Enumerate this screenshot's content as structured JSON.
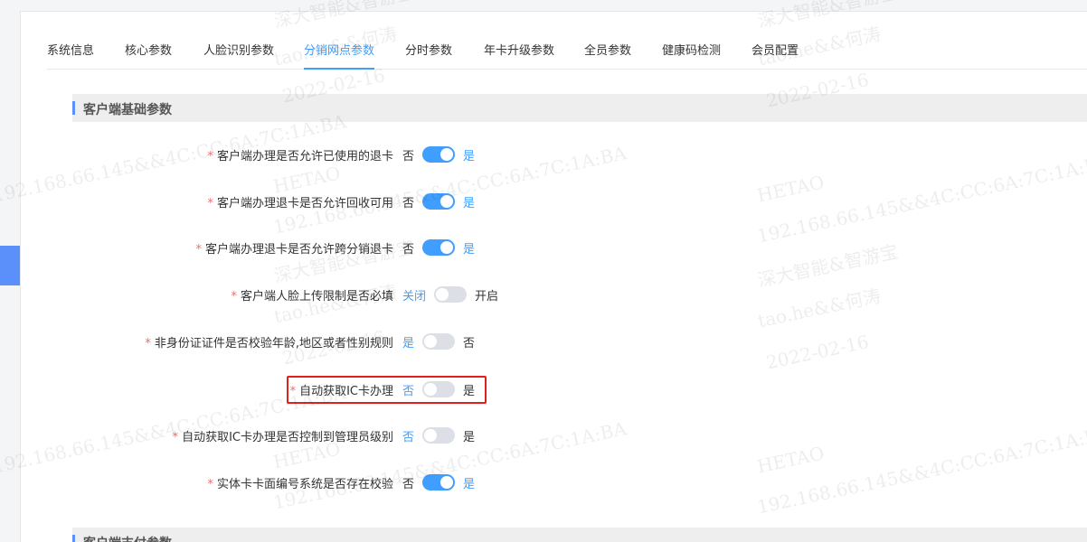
{
  "tabs": [
    {
      "label": "系统信息",
      "active": false
    },
    {
      "label": "核心参数",
      "active": false
    },
    {
      "label": "人脸识别参数",
      "active": false
    },
    {
      "label": "分销网点参数",
      "active": true
    },
    {
      "label": "分时参数",
      "active": false
    },
    {
      "label": "年卡升级参数",
      "active": false
    },
    {
      "label": "全员参数",
      "active": false
    },
    {
      "label": "健康码检测",
      "active": false
    },
    {
      "label": "会员配置",
      "active": false
    }
  ],
  "sections": {
    "client_basic": {
      "title": "客户端基础参数"
    },
    "client_payment": {
      "title": "客户端支付参数"
    }
  },
  "required_mark": "*",
  "form": [
    {
      "label": "客户端办理是否允许已使用的退卡",
      "left": "否",
      "right": "是",
      "on": true
    },
    {
      "label": "客户端办理退卡是否允许回收可用",
      "left": "否",
      "right": "是",
      "on": true
    },
    {
      "label": "客户端办理退卡是否允许跨分销退卡",
      "left": "否",
      "right": "是",
      "on": true
    },
    {
      "label": "客户端人脸上传限制是否必填",
      "left": "关闭",
      "right": "开启",
      "on": false
    },
    {
      "label": "非身份证证件是否校验年龄,地区或者性别规则",
      "left": "是",
      "right": "否",
      "on": false
    },
    {
      "label": "自动获取IC卡办理",
      "left": "否",
      "right": "是",
      "on": false
    },
    {
      "label": "自动获取IC卡办理是否控制到管理员级别",
      "left": "否",
      "right": "是",
      "on": false
    },
    {
      "label": "实体卡卡面编号系统是否存在校验",
      "left": "否",
      "right": "是",
      "on": true
    }
  ],
  "watermark": {
    "lines": [
      "HETAO",
      "192.168.66.145&&4C:CC:6A:7C:1A:BA",
      "深大智能&智游宝",
      "tao.he&&何涛",
      "2022-02-16"
    ]
  },
  "colors": {
    "accent": "#409eff",
    "required": "#f56c6c",
    "highlight": "#e02020",
    "section_bg": "#eeeeee",
    "section_bar": "#5b8ff9"
  }
}
